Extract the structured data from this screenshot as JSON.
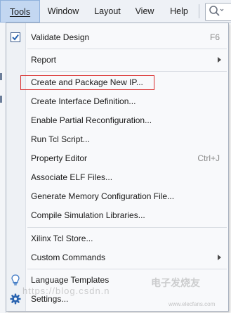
{
  "menubar": {
    "items": [
      {
        "label": "Tools",
        "mnemonic": "T"
      },
      {
        "label": "Window"
      },
      {
        "label": "Layout"
      },
      {
        "label": "View"
      },
      {
        "label": "Help"
      }
    ]
  },
  "search": {
    "icon": "search-icon"
  },
  "menu": {
    "validate": {
      "label": "Validate Design",
      "shortcut": "F6",
      "checked": true
    },
    "report": {
      "label": "Report"
    },
    "create_package": {
      "label": "Create and Package New IP..."
    },
    "create_interface": {
      "label": "Create Interface Definition..."
    },
    "enable_partial": {
      "label": "Enable Partial Reconfiguration..."
    },
    "run_tcl": {
      "label": "Run Tcl Script..."
    },
    "property_editor": {
      "label": "Property Editor",
      "shortcut": "Ctrl+J"
    },
    "associate_elf": {
      "label": "Associate ELF Files..."
    },
    "gen_memory": {
      "label": "Generate Memory Configuration File..."
    },
    "compile_sim": {
      "label": "Compile Simulation Libraries..."
    },
    "tcl_store": {
      "label": "Xilinx Tcl Store..."
    },
    "custom_commands": {
      "label": "Custom Commands"
    },
    "lang_templates": {
      "label": "Language Templates"
    },
    "settings": {
      "label": "Settings..."
    }
  },
  "watermark": {
    "url": "https://blog.csdn.n",
    "logo": "电子发烧友",
    "site": "www.elecfans.com"
  },
  "colors": {
    "highlight_box": "#d92b2b",
    "active_menu": "#c3d7f1",
    "icon_blue": "#2a64b0"
  }
}
